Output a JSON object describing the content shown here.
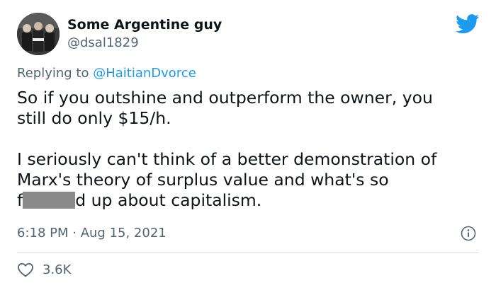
{
  "author": {
    "name": "Some Argentine guy",
    "handle": "@dsal1829"
  },
  "reply": {
    "prefix": "Replying to ",
    "mention": "@HaitianDvorce"
  },
  "body": {
    "line1": "So if you outshine and outperform the owner, you",
    "line2": "still do only $15/h.",
    "line3": "I seriously can't think of a better demonstration of",
    "line4": "Marx's theory of surplus value and what's so",
    "line5_start": "f",
    "line5_end": "d up about capitalism."
  },
  "meta": {
    "timestamp": "6:18 PM · Aug 15, 2021"
  },
  "stats": {
    "likes": "3.6K"
  },
  "colors": {
    "brand_blue": "#1d9bf0",
    "text_primary": "#0f1419",
    "text_secondary": "#536471",
    "censor_gray": "#8a8a8a"
  },
  "icons": {
    "logo": "twitter-bird-icon",
    "info": "info-icon",
    "like": "heart-icon"
  }
}
